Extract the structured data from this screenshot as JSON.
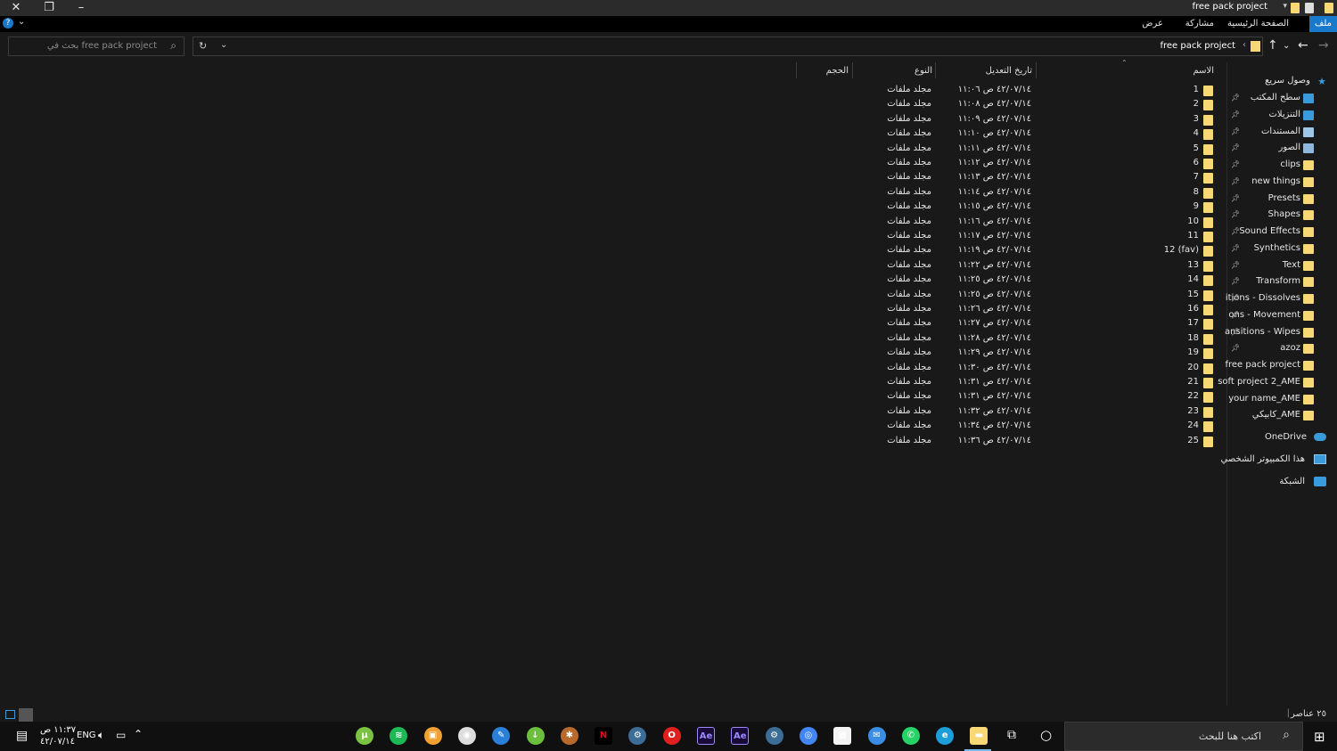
{
  "window": {
    "title": "free pack project",
    "close_icon": "close-icon",
    "restore_icon": "restore-icon",
    "minimize_icon": "minimize-icon"
  },
  "ribbon": {
    "tabs": [
      "ملف",
      "الصفحة الرئيسية",
      "مشاركة",
      "عرض"
    ],
    "active_tab": "ملف"
  },
  "address": {
    "path": "free pack project",
    "search_placeholder": "بحث في free pack project"
  },
  "columns": {
    "name": "الاسم",
    "date": "تاريخ التعديل",
    "type": "النوع",
    "size": "الحجم"
  },
  "files": [
    {
      "name": "1",
      "date": "٤٢/٠٧/١٤ ص ١١:٠٦",
      "type": "مجلد ملفات"
    },
    {
      "name": "2",
      "date": "٤٢/٠٧/١٤ ص ١١:٠٨",
      "type": "مجلد ملفات"
    },
    {
      "name": "3",
      "date": "٤٢/٠٧/١٤ ص ١١:٠٩",
      "type": "مجلد ملفات"
    },
    {
      "name": "4",
      "date": "٤٢/٠٧/١٤ ص ١١:١٠",
      "type": "مجلد ملفات"
    },
    {
      "name": "5",
      "date": "٤٢/٠٧/١٤ ص ١١:١١",
      "type": "مجلد ملفات"
    },
    {
      "name": "6",
      "date": "٤٢/٠٧/١٤ ص ١١:١٢",
      "type": "مجلد ملفات"
    },
    {
      "name": "7",
      "date": "٤٢/٠٧/١٤ ص ١١:١٣",
      "type": "مجلد ملفات"
    },
    {
      "name": "8",
      "date": "٤٢/٠٧/١٤ ص ١١:١٤",
      "type": "مجلد ملفات"
    },
    {
      "name": "9",
      "date": "٤٢/٠٧/١٤ ص ١١:١٥",
      "type": "مجلد ملفات"
    },
    {
      "name": "10",
      "date": "٤٢/٠٧/١٤ ص ١١:١٦",
      "type": "مجلد ملفات"
    },
    {
      "name": "11",
      "date": "٤٢/٠٧/١٤ ص ١١:١٧",
      "type": "مجلد ملفات"
    },
    {
      "name": "12 (fav)",
      "date": "٤٢/٠٧/١٤ ص ١١:١٩",
      "type": "مجلد ملفات"
    },
    {
      "name": "13",
      "date": "٤٢/٠٧/١٤ ص ١١:٢٢",
      "type": "مجلد ملفات"
    },
    {
      "name": "14",
      "date": "٤٢/٠٧/١٤ ص ١١:٢٥",
      "type": "مجلد ملفات"
    },
    {
      "name": "15",
      "date": "٤٢/٠٧/١٤ ص ١١:٢٥",
      "type": "مجلد ملفات"
    },
    {
      "name": "16",
      "date": "٤٢/٠٧/١٤ ص ١١:٢٦",
      "type": "مجلد ملفات"
    },
    {
      "name": "17",
      "date": "٤٢/٠٧/١٤ ص ١١:٢٧",
      "type": "مجلد ملفات"
    },
    {
      "name": "18",
      "date": "٤٢/٠٧/١٤ ص ١١:٢٨",
      "type": "مجلد ملفات"
    },
    {
      "name": "19",
      "date": "٤٢/٠٧/١٤ ص ١١:٢٩",
      "type": "مجلد ملفات"
    },
    {
      "name": "20",
      "date": "٤٢/٠٧/١٤ ص ١١:٣٠",
      "type": "مجلد ملفات"
    },
    {
      "name": "21",
      "date": "٤٢/٠٧/١٤ ص ١١:٣١",
      "type": "مجلد ملفات"
    },
    {
      "name": "22",
      "date": "٤٢/٠٧/١٤ ص ١١:٣١",
      "type": "مجلد ملفات"
    },
    {
      "name": "23",
      "date": "٤٢/٠٧/١٤ ص ١١:٣٢",
      "type": "مجلد ملفات"
    },
    {
      "name": "24",
      "date": "٤٢/٠٧/١٤ ص ١١:٣٤",
      "type": "مجلد ملفات"
    },
    {
      "name": "25",
      "date": "٤٢/٠٧/١٤ ص ١١:٣٦",
      "type": "مجلد ملفات"
    }
  ],
  "nav": {
    "quick_access": "وصول سريع",
    "items": [
      {
        "label": "سطح المكتب",
        "icon": "desktop-icon",
        "pinned": true,
        "color": "#3a9bdc"
      },
      {
        "label": "التنزيلات",
        "icon": "download-icon",
        "pinned": true,
        "color": "#3a9bdc"
      },
      {
        "label": "المستندات",
        "icon": "documents-icon",
        "pinned": true,
        "color": "#9ec6e8"
      },
      {
        "label": "الصور",
        "icon": "pictures-icon",
        "pinned": true,
        "color": "#8fb8de"
      },
      {
        "label": "clips",
        "icon": "folder-icon",
        "pinned": true,
        "color": "#f8d775"
      },
      {
        "label": "new things",
        "icon": "folder-icon",
        "pinned": true,
        "color": "#f8d775"
      },
      {
        "label": "Presets",
        "icon": "folder-icon",
        "pinned": true,
        "color": "#f8d775"
      },
      {
        "label": "Shapes",
        "icon": "folder-icon",
        "pinned": true,
        "color": "#f8d775"
      },
      {
        "label": "Sound Effects",
        "icon": "folder-icon",
        "pinned": true,
        "color": "#f8d775"
      },
      {
        "label": "Synthetics",
        "icon": "folder-icon",
        "pinned": true,
        "color": "#f8d775"
      },
      {
        "label": "Text",
        "icon": "folder-icon",
        "pinned": true,
        "color": "#f8d775"
      },
      {
        "label": "Transform",
        "icon": "folder-icon",
        "pinned": true,
        "color": "#f8d775"
      },
      {
        "label": "itions - Dissolves",
        "icon": "folder-icon",
        "pinned": true,
        "color": "#f8d775"
      },
      {
        "label": "ons - Movement",
        "icon": "folder-icon",
        "pinned": true,
        "color": "#f8d775"
      },
      {
        "label": "ansitions - Wipes",
        "icon": "folder-icon",
        "pinned": true,
        "color": "#f8d775"
      },
      {
        "label": "azoz",
        "icon": "folder-icon",
        "pinned": true,
        "color": "#f8d775"
      },
      {
        "label": "free pack project",
        "icon": "folder-icon",
        "pinned": false,
        "color": "#f8d775"
      },
      {
        "label": "soft project 2_AME",
        "icon": "folder-icon",
        "pinned": false,
        "color": "#f8d775"
      },
      {
        "label": "your name_AME",
        "icon": "folder-icon",
        "pinned": false,
        "color": "#f8d775"
      },
      {
        "label": "كابيكي_AME",
        "icon": "folder-icon",
        "pinned": false,
        "color": "#f8d775"
      }
    ],
    "onedrive": "OneDrive",
    "this_pc": "هذا الكمبيوتر الشخصي",
    "network": "الشبكة"
  },
  "status": {
    "count": "٢٥ عناصر"
  },
  "taskbar": {
    "search_placeholder": "اكتب هنا للبحث",
    "lang": "ENG",
    "time": "١١:٣٧ ص",
    "date": "٤٢/٠٧/١٤",
    "apps": [
      {
        "name": "utorrent-icon",
        "color": "#7cc242",
        "glyph": "µ"
      },
      {
        "name": "spotify-icon",
        "color": "#1db954",
        "glyph": "≋"
      },
      {
        "name": "app-orange-icon",
        "color": "#f0a030",
        "glyph": "▣"
      },
      {
        "name": "camera-app-icon",
        "color": "#dddddd",
        "glyph": "◉"
      },
      {
        "name": "paint-app-icon",
        "color": "#2a7fd8",
        "glyph": "✎"
      },
      {
        "name": "idm-icon",
        "color": "#6cbf3c",
        "glyph": "↓"
      },
      {
        "name": "game-app-icon",
        "color": "#b86a2c",
        "glyph": "✱"
      },
      {
        "name": "netflix-icon",
        "color": "#e50914",
        "glyph": "N"
      },
      {
        "name": "steam-icon",
        "color": "#3c6d96",
        "glyph": "⚙"
      },
      {
        "name": "opera-icon",
        "color": "#e0201e",
        "glyph": "O"
      },
      {
        "name": "after-effects-icon",
        "color": "#9a8cff",
        "glyph": "Ae"
      },
      {
        "name": "after-effects-2-icon",
        "color": "#9a8cff",
        "glyph": "Ae"
      },
      {
        "name": "steam-2-icon",
        "color": "#3c6d96",
        "glyph": "⚙"
      },
      {
        "name": "chrome-icon",
        "color": "#4285f4",
        "glyph": "◎"
      },
      {
        "name": "store-icon",
        "color": "#f3f3f3",
        "glyph": "▦"
      },
      {
        "name": "mail-icon",
        "color": "#3a8ee6",
        "glyph": "✉"
      },
      {
        "name": "whatsapp-icon",
        "color": "#25d366",
        "glyph": "✆"
      },
      {
        "name": "edge-icon",
        "color": "#1e9ed8",
        "glyph": "e"
      },
      {
        "name": "file-explorer-icon",
        "color": "#f8d775",
        "glyph": "▬"
      }
    ]
  }
}
